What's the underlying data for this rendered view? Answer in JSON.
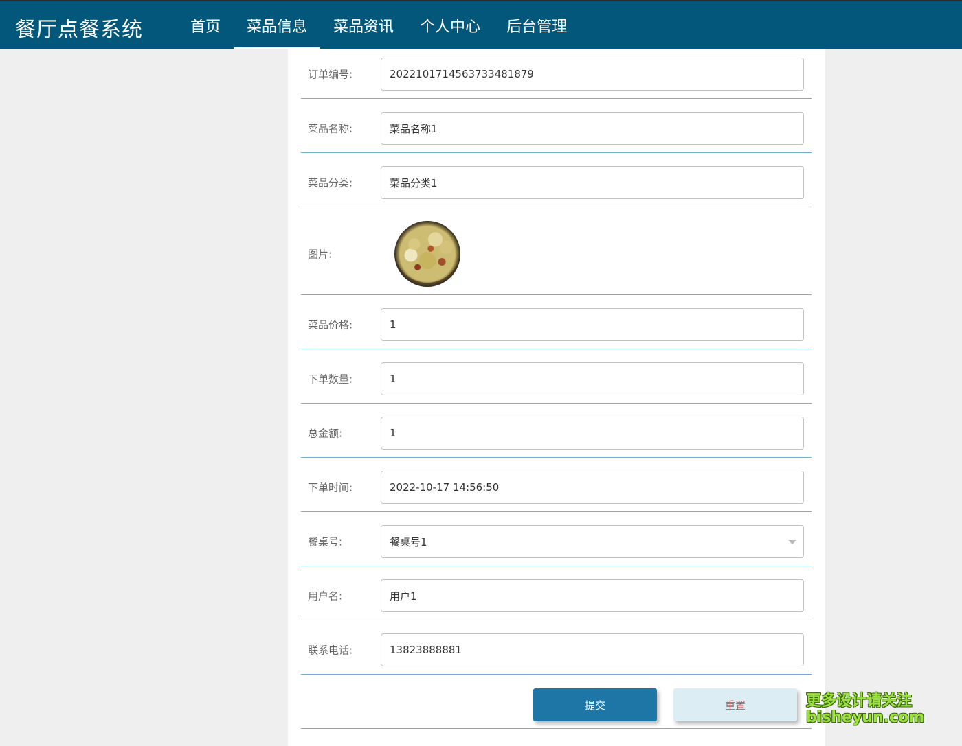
{
  "header": {
    "brand": "餐厅点餐系统",
    "nav": [
      "首页",
      "菜品信息",
      "菜品资讯",
      "个人中心",
      "后台管理"
    ],
    "active_index": 1
  },
  "form": {
    "order_no": {
      "label": "订单编号:",
      "value": "20221017145637334818 79"
    },
    "dish_name": {
      "label": "菜品名称:",
      "value": "菜品名称1"
    },
    "dish_category": {
      "label": "菜品分类:",
      "value": "菜品分类1"
    },
    "image": {
      "label": "图片:"
    },
    "dish_price": {
      "label": "菜品价格:",
      "value": "1"
    },
    "quantity": {
      "label": "下单数量:",
      "value": "1"
    },
    "total": {
      "label": "总金额:",
      "value": "1"
    },
    "order_time": {
      "label": "下单时间:",
      "value": "2022-10-17 14:56:50"
    },
    "table_no": {
      "label": "餐桌号:",
      "value": "餐桌号1"
    },
    "username": {
      "label": "用户名:",
      "value": "用户1"
    },
    "phone": {
      "label": "联系电话:",
      "value": "13823888881"
    }
  },
  "actions": {
    "submit": "提交",
    "reset": "重置"
  },
  "watermark": {
    "line1": "更多设计请关注",
    "line2": "bisheyun.com"
  }
}
